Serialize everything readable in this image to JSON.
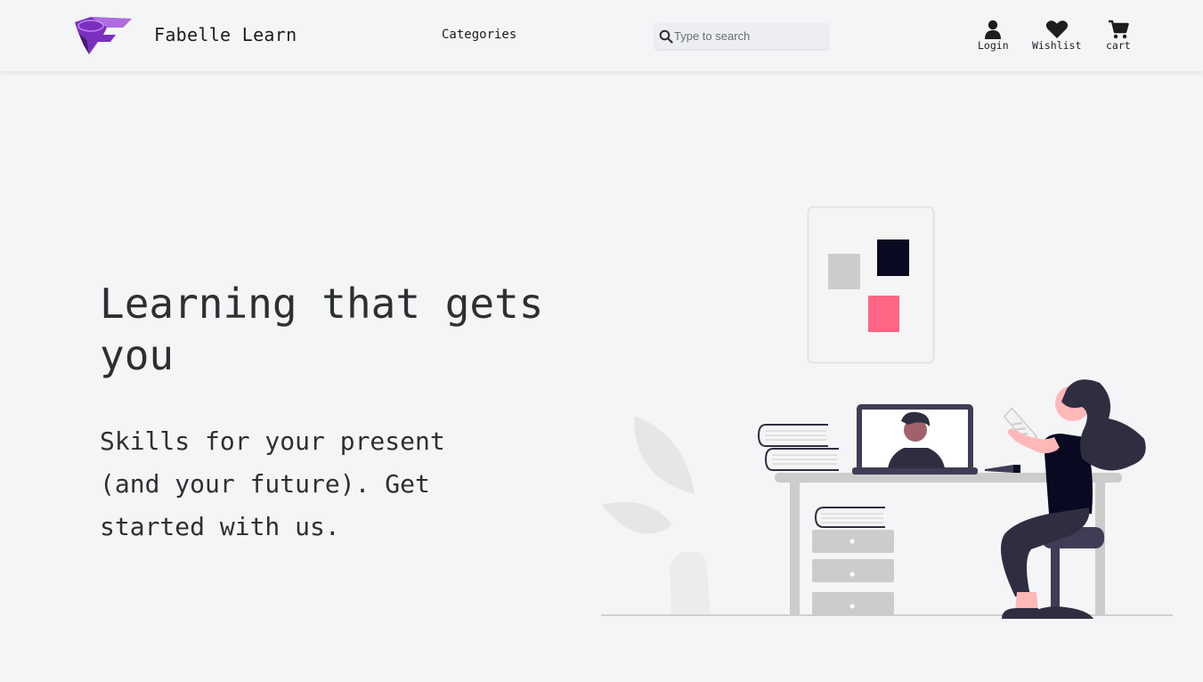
{
  "header": {
    "brand": "Fabelle Learn",
    "categories_label": "Categories",
    "search_placeholder": "Type to search",
    "login_label": "Login",
    "wishlist_label": "Wishlist",
    "cart_label": "cart"
  },
  "hero": {
    "title": "Learning that gets you",
    "subtitle": "Skills for your present (and your future). Get started with us."
  },
  "icons": {
    "logo": "fabelle-logo-icon",
    "search": "search-icon",
    "login": "user-icon",
    "wishlist": "heart-icon",
    "cart": "cart-icon"
  },
  "colors": {
    "background": "#f4f5f7",
    "accent_pink": "#ff6584",
    "logo_purple": "#7b2fbf",
    "dark": "#2f2e41"
  }
}
